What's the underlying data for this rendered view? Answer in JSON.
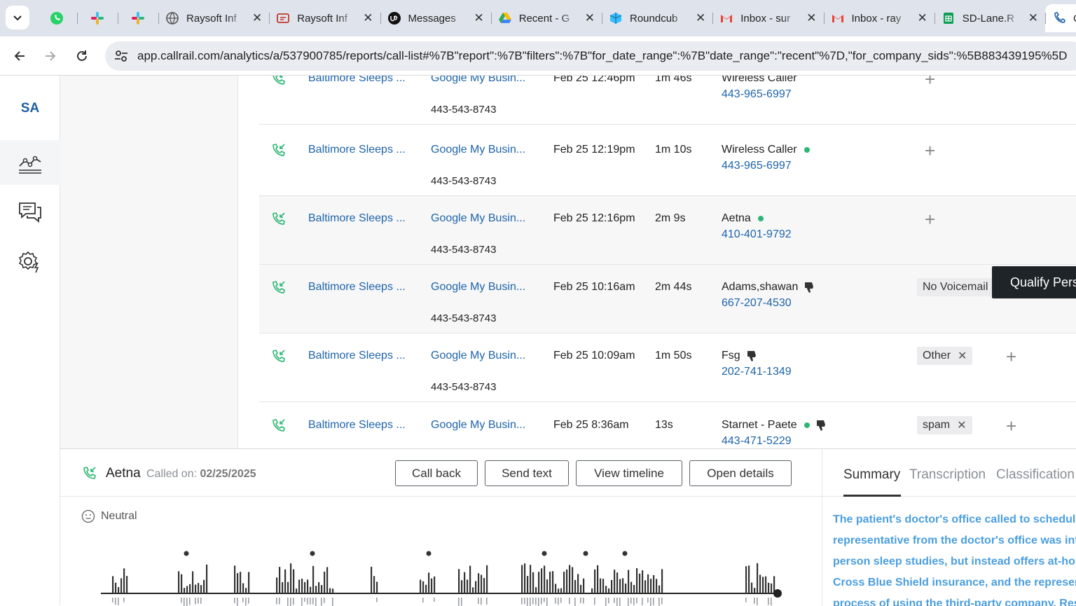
{
  "browser": {
    "tabs": [
      {
        "icon": "whatsapp-icon",
        "title": ""
      },
      {
        "icon": "slack-icon",
        "title": ""
      },
      {
        "icon": "slack-icon",
        "title": ""
      },
      {
        "icon": "globe-icon",
        "title": "Raysoft Inf"
      },
      {
        "icon": "raysoft-icon",
        "title": "Raysoft Inf"
      },
      {
        "icon": "upwork-icon",
        "title": "Messages"
      },
      {
        "icon": "google-drive-icon",
        "title": "Recent - G"
      },
      {
        "icon": "roundcube-icon",
        "title": "Roundcub"
      },
      {
        "icon": "gmail-icon",
        "title": "Inbox - sur"
      },
      {
        "icon": "gmail-icon",
        "title": "Inbox - ray"
      },
      {
        "icon": "sheets-icon",
        "title": "SD-Lane.R"
      },
      {
        "icon": "callrail-icon",
        "title": "C"
      }
    ],
    "url": "app.callrail.com/analytics/a/537900785/reports/call-list#%7B\"report\":%7B\"filters\":%7B\"for_date_range\":%7B\"date_range\":\"recent\"%7D,\"for_company_sids\":%5B883439195%5D"
  },
  "rail": {
    "initials": "SA",
    "items": [
      "analytics-icon",
      "conversations-icon",
      "settings-icon"
    ]
  },
  "calls": [
    {
      "account": "Baltimore Sleeps ...",
      "source": "Google My Busin...",
      "tracking": "443-543-8743",
      "when": "Feb 25 12:46pm",
      "duration": "1m 46s",
      "caller": "Wireless Caller",
      "phone": "443-965-6997",
      "dot": false,
      "thumb": false,
      "tag": ""
    },
    {
      "account": "Baltimore Sleeps ...",
      "source": "Google My Busin...",
      "tracking": "443-543-8743",
      "when": "Feb 25 12:19pm",
      "duration": "1m 10s",
      "caller": "Wireless Caller",
      "phone": "443-965-6997",
      "dot": true,
      "thumb": false,
      "tag": ""
    },
    {
      "account": "Baltimore Sleeps ...",
      "source": "Google My Busin...",
      "tracking": "443-543-8743",
      "when": "Feb 25 12:16pm",
      "duration": "2m 9s",
      "caller": "Aetna",
      "phone": "410-401-9792",
      "dot": true,
      "thumb": false,
      "tag": ""
    },
    {
      "account": "Baltimore Sleeps ...",
      "source": "Google My Busin...",
      "tracking": "443-543-8743",
      "when": "Feb 25 10:16am",
      "duration": "2m 44s",
      "caller": "Adams,shawan",
      "phone": "667-207-4530",
      "dot": false,
      "thumb": true,
      "tag": "No Voicemail"
    },
    {
      "account": "Baltimore Sleeps ...",
      "source": "Google My Busin...",
      "tracking": "443-543-8743",
      "when": "Feb 25 10:09am",
      "duration": "1m 50s",
      "caller": "Fsg",
      "phone": "202-741-1349",
      "dot": false,
      "thumb": true,
      "tag": "Other"
    },
    {
      "account": "Baltimore Sleeps ...",
      "source": "Google My Busin...",
      "tracking": "443-543-8743",
      "when": "Feb 25 8:36am",
      "duration": "13s",
      "caller": "Starnet - Paete",
      "phone": "443-471-5229",
      "dot": true,
      "thumb": true,
      "tag": "spam"
    }
  ],
  "qualify_label": "Qualify Pers",
  "detail": {
    "caller": "Aetna",
    "called_on_label": "Called on:",
    "called_on_date": "02/25/2025",
    "buttons": [
      "Call back",
      "Send text",
      "View timeline",
      "Open details"
    ],
    "sentiment": "Neutral",
    "tabs": [
      "Summary",
      "Transcription",
      "Classification"
    ],
    "summary_lines": [
      "The patient's doctor's office called to schedule",
      "representative from the doctor's office was info",
      "person sleep studies, but instead offers at-hom",
      "Cross Blue Shield insurance, and the represent",
      "process of using the third-party company. Rest"
    ]
  },
  "colors": {
    "link": "#1e64a9",
    "accent_green": "#2db673",
    "summary_text": "#4a9ee0"
  }
}
